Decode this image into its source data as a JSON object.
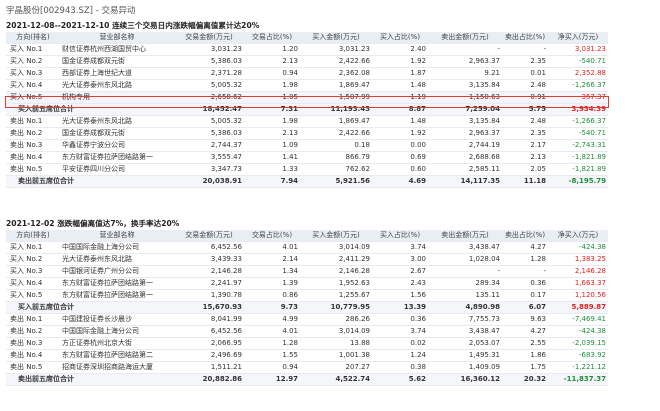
{
  "page": {
    "title": "宇晶股份[002943.SZ] - 交易异动"
  },
  "columns": [
    "方向(排名)",
    "营业部名称",
    "交易金额(万元)",
    "交易占比(%)",
    "买入金额(万元)",
    "买入占比(%)",
    "卖出金额(万元)",
    "卖出占比(%)",
    "净买入(万元)"
  ],
  "sections": [
    {
      "title": "2021-12-08--2021-12-10 连续三个交易日内涨跌幅偏离值累计达20%",
      "rows": [
        [
          "买入 No.1",
          "财信证券杭州西湖国贸中心",
          "3,031.23",
          "1.20",
          "3,031.23",
          "2.40",
          "-",
          "-",
          "3,031.23"
        ],
        [
          "买入 No.2",
          "国金证券成都双元街",
          "5,386.03",
          "2.13",
          "2,422.66",
          "1.92",
          "2,963.37",
          "2.35",
          "-540.71"
        ],
        [
          "买入 No.3",
          "西部证券上海世纪大道",
          "2,371.28",
          "0.94",
          "2,362.08",
          "1.87",
          "9.21",
          "0.01",
          "2,352.88"
        ],
        [
          "买入 No.4",
          "光大证券泰州东风北路",
          "5,005.32",
          "1.98",
          "1,869.47",
          "1.48",
          "3,135.84",
          "2.48",
          "-1,266.37"
        ],
        [
          "买入 No.5",
          "机构专用",
          "2,658.62",
          "1.05",
          "1,507.99",
          "1.19",
          "1,150.63",
          "0.91",
          "357.37"
        ],
        [
          "买入前五席位合计",
          "",
          "18,452.47",
          "7.31",
          "11,193.43",
          "8.87",
          "7,259.04",
          "5.75",
          "3,934.39"
        ],
        [
          "卖出 No.1",
          "光大证券泰州东风北路",
          "5,005.32",
          "1.98",
          "1,869.47",
          "1.48",
          "3,135.84",
          "2.48",
          "-1,266.37"
        ],
        [
          "卖出 No.2",
          "国金证券成都双元街",
          "5,386.03",
          "2.13",
          "2,422.66",
          "1.92",
          "2,963.37",
          "2.35",
          "-540.71"
        ],
        [
          "卖出 No.3",
          "华鑫证券宁波分公司",
          "2,744.37",
          "1.09",
          "0.18",
          "0.00",
          "2,744.19",
          "2.17",
          "-2,743.31"
        ],
        [
          "卖出 No.4",
          "东方财富证券拉萨团结路第一",
          "3,555.47",
          "1.41",
          "866.79",
          "0.69",
          "2,688.68",
          "2.13",
          "-1,821.89"
        ],
        [
          "卖出 No.5",
          "平安证券四川分公司",
          "3,347.73",
          "1.33",
          "762.62",
          "0.60",
          "2,585.11",
          "2.05",
          "-1,821.89"
        ],
        [
          "卖出前五席位合计",
          "",
          "20,038.91",
          "7.94",
          "5,921.56",
          "4.69",
          "14,117.35",
          "11.18",
          "-8,195.79"
        ]
      ]
    },
    {
      "title": "2021-12-02 涨跌幅偏离值达7%，换手率达20%",
      "rows": [
        [
          "买入 No.1",
          "中国国际金融上海分公司",
          "6,452.56",
          "4.01",
          "3,014.09",
          "3.74",
          "3,438.47",
          "4.27",
          "-424.38"
        ],
        [
          "买入 No.2",
          "光大证券泰州东风北路",
          "3,439.33",
          "2.14",
          "2,411.29",
          "3.00",
          "1,028.04",
          "1.28",
          "1,383.25"
        ],
        [
          "买入 No.3",
          "中国银河证券广州分公司",
          "2,146.28",
          "1.34",
          "2,146.28",
          "2.67",
          "-",
          "-",
          "2,146.28"
        ],
        [
          "买入 No.4",
          "东方财富证券拉萨团结路第一",
          "2,241.97",
          "1.39",
          "1,952.63",
          "2.43",
          "289.34",
          "0.36",
          "1,663.37"
        ],
        [
          "买入 No.5",
          "东方财富证券拉萨团结路第一",
          "1,390.78",
          "0.86",
          "1,255.67",
          "1.56",
          "135.11",
          "0.17",
          "1,120.56"
        ],
        [
          "买入前五席位合计",
          "",
          "15,670.93",
          "9.73",
          "10,779.95",
          "13.39",
          "4,890.98",
          "6.07",
          "5,889.87"
        ],
        [
          "卖出 No.1",
          "中国建投证券长沙晨沙",
          "8,041.99",
          "4.99",
          "286.26",
          "0.36",
          "7,755.73",
          "9.63",
          "-7,469.41"
        ],
        [
          "卖出 No.2",
          "中国国际金融上海分公司",
          "6,452.56",
          "4.01",
          "3,014.09",
          "3.74",
          "3,438.47",
          "4.27",
          "-424.38"
        ],
        [
          "卖出 No.3",
          "方正证券杭州北京大街",
          "2,066.95",
          "1.28",
          "13.88",
          "0.02",
          "2,053.07",
          "2.55",
          "-2,039.15"
        ],
        [
          "卖出 No.4",
          "东方财富证券拉萨团结路第二",
          "2,496.69",
          "1.55",
          "1,001.38",
          "1.24",
          "1,495.31",
          "1.86",
          "-683.92"
        ],
        [
          "卖出 No.5",
          "招商证券深圳招商路海运大厦",
          "1,511.21",
          "0.94",
          "207.27",
          "0.38",
          "1,409.09",
          "1.75",
          "-1,221.12"
        ],
        [
          "卖出前五席位合计",
          "",
          "20,882.86",
          "12.97",
          "4,522.74",
          "5.62",
          "16,360.12",
          "20.32",
          "-11,837.37"
        ]
      ]
    }
  ],
  "colors": {
    "positive": "#e02020",
    "negative": "#1f8e3a",
    "highlight_border": "#e53935",
    "header_bg": "#e9eef5"
  }
}
